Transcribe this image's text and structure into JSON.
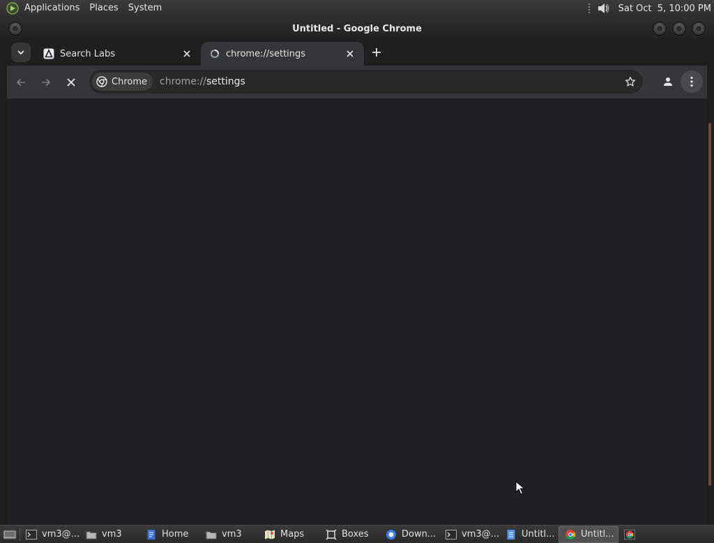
{
  "top_panel": {
    "menus": [
      "Applications",
      "Places",
      "System"
    ],
    "clock": "Sat Oct  5, 10:00 PM"
  },
  "window": {
    "title": "Untitled - Google Chrome"
  },
  "browser": {
    "tabs": [
      {
        "title": "Search Labs",
        "active": false,
        "favicon": "search-labs-icon"
      },
      {
        "title": "chrome://settings",
        "active": true,
        "favicon": "loading-icon"
      }
    ],
    "omnibox": {
      "chip_label": "Chrome",
      "url_scheme": "chrome://",
      "url_rest": "settings"
    }
  },
  "taskbar": {
    "items": [
      {
        "label": "vm3@...",
        "icon": "terminal-icon"
      },
      {
        "label": "vm3",
        "icon": "folder-icon"
      },
      {
        "label": "Home",
        "icon": "document-icon"
      },
      {
        "label": "vm3",
        "icon": "folder-icon"
      },
      {
        "label": "Maps",
        "icon": "maps-icon"
      },
      {
        "label": "Boxes",
        "icon": "boxes-icon"
      },
      {
        "label": "Down...",
        "icon": "browser-icon"
      },
      {
        "label": "vm3@...",
        "icon": "terminal-icon"
      },
      {
        "label": "Untitl...",
        "icon": "text-editor-icon"
      },
      {
        "label": "Untitl...",
        "icon": "chrome-icon"
      }
    ]
  },
  "colors": {
    "content_bg": "#202124",
    "toolbar_bg": "#35363a",
    "tabstrip_bg": "#1f1f1f"
  }
}
